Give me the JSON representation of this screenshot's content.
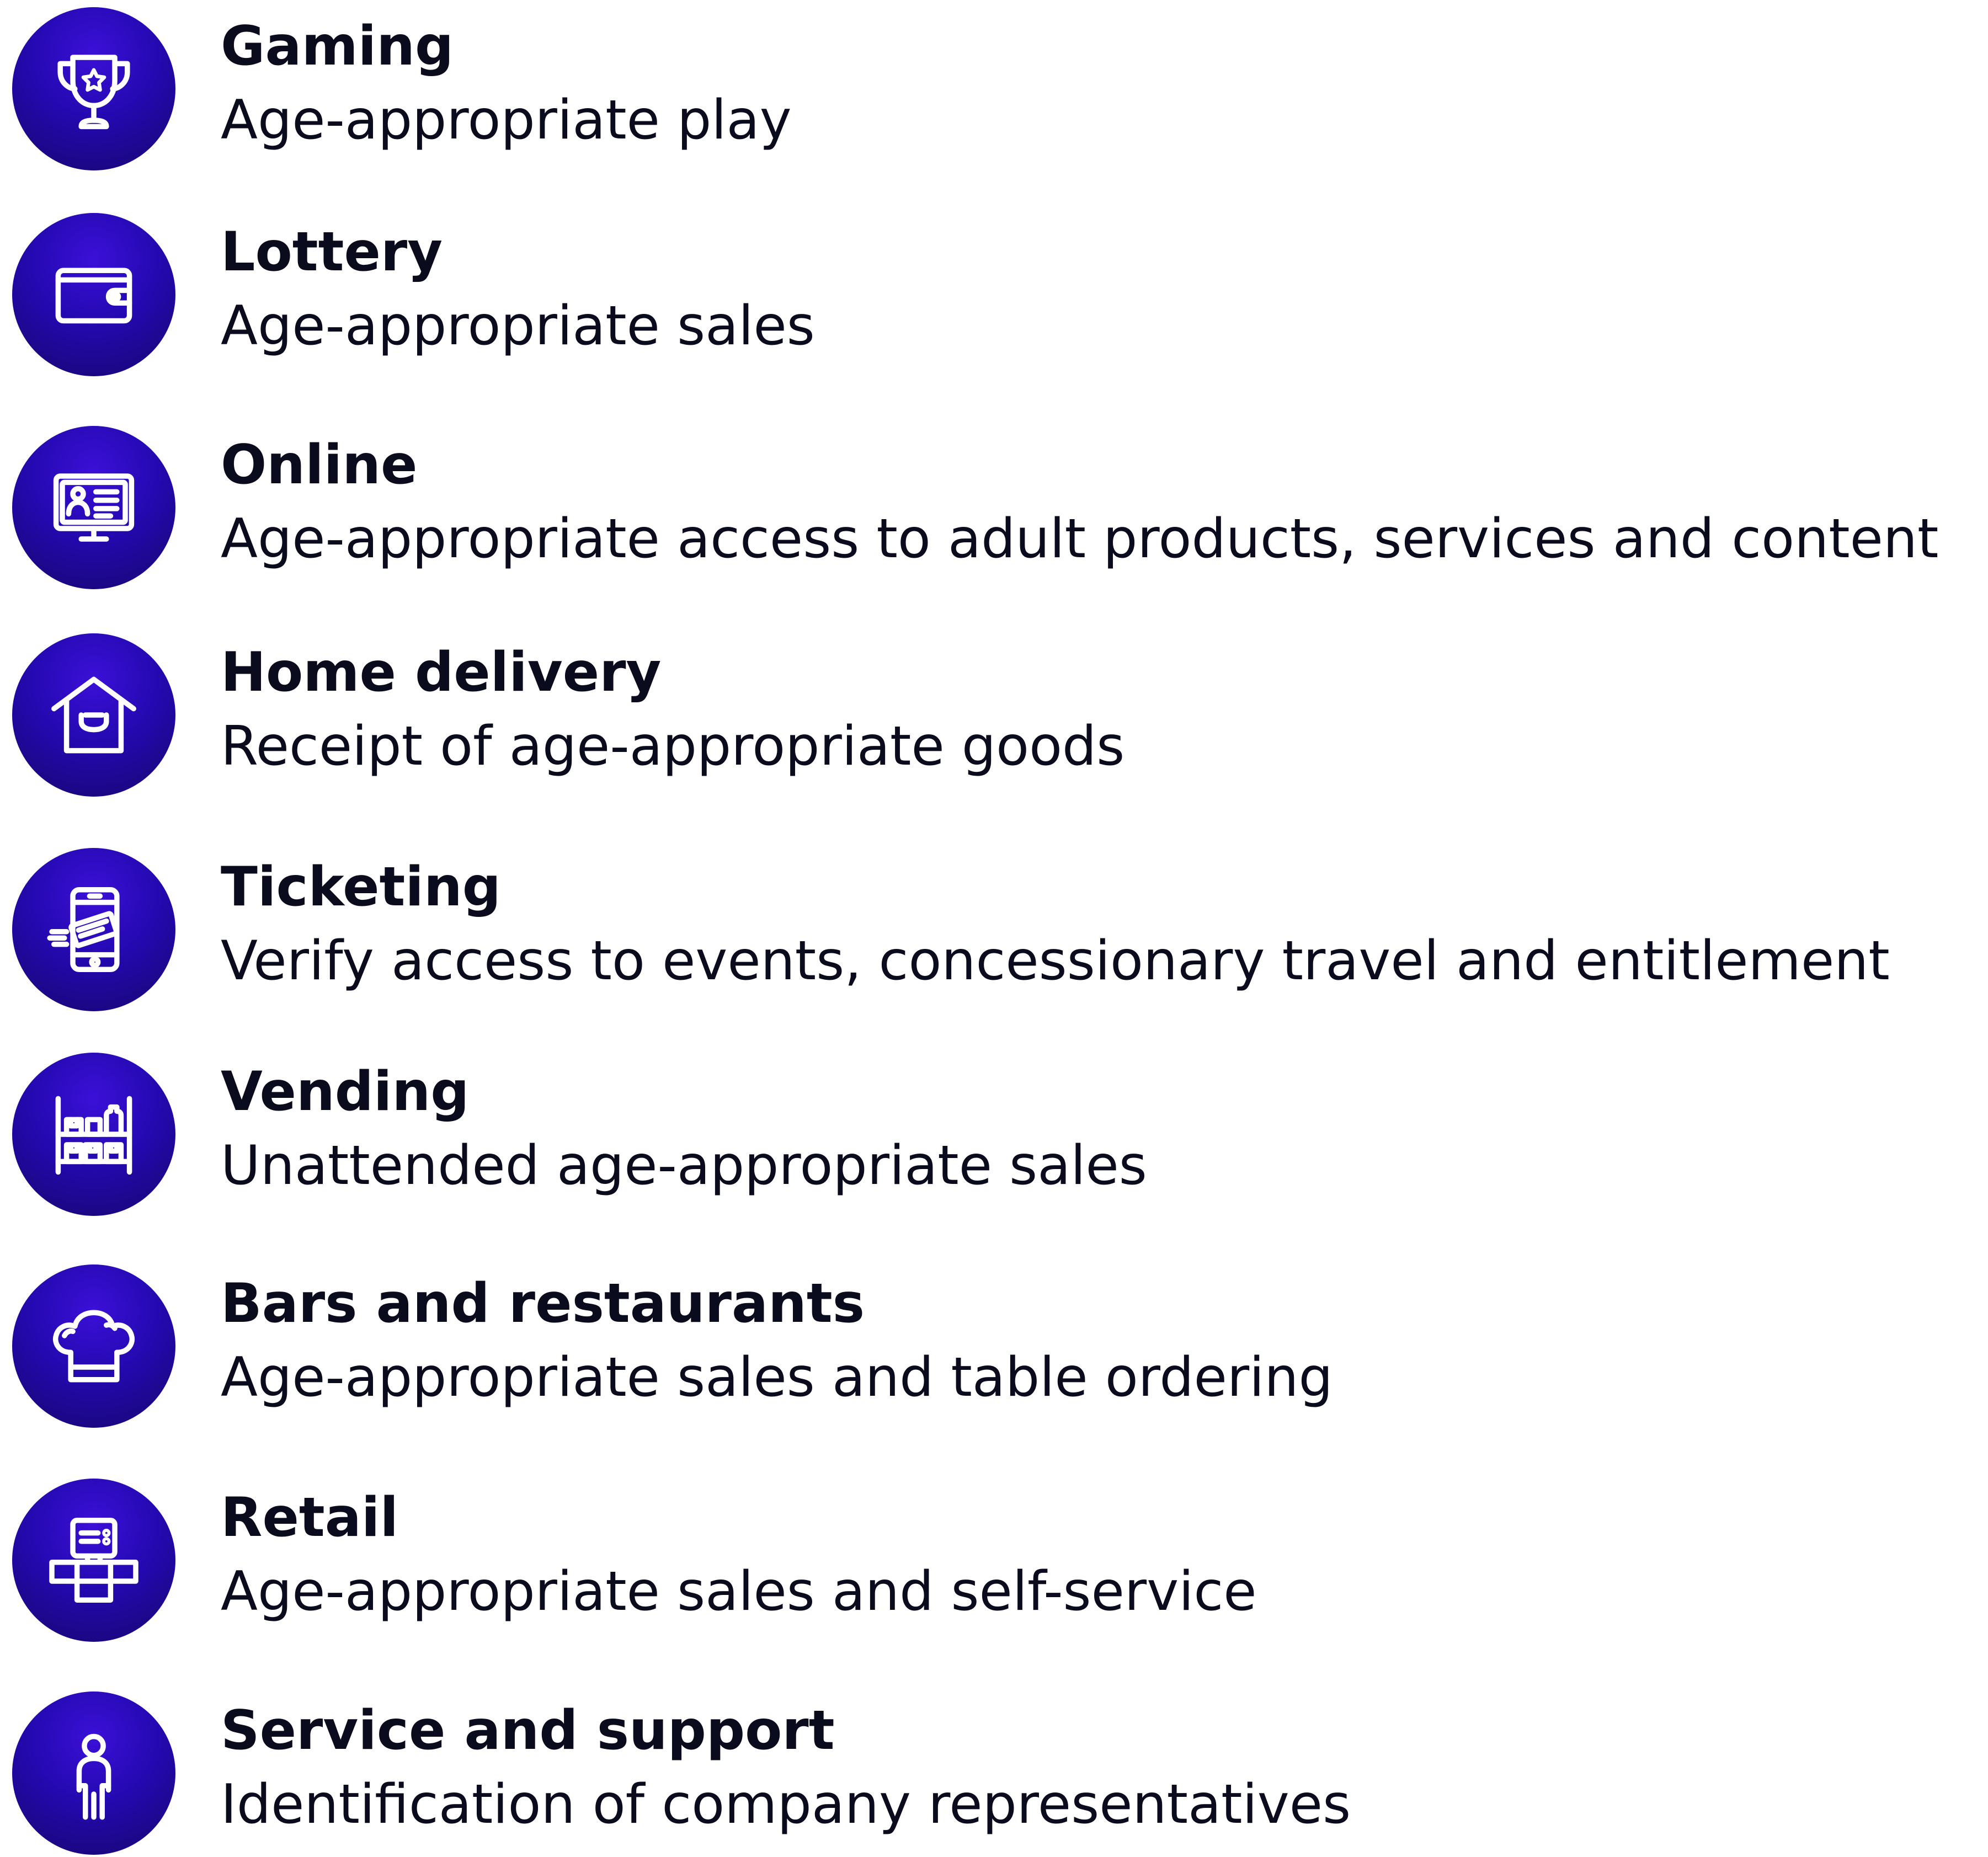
{
  "colors": {
    "icon_circle": "#2409b0",
    "icon_circle_dark": "#16066f",
    "icon_stroke": "#ffffff",
    "text": "#0b0b1e"
  },
  "items": [
    {
      "title": "Gaming",
      "description": "Age-appropriate play",
      "icon": "trophy-icon"
    },
    {
      "title": "Lottery",
      "description": "Age-appropriate sales",
      "icon": "wallet-icon"
    },
    {
      "title": "Online",
      "description": "Age-appropriate access to adult products, services and content",
      "icon": "monitor-profile-icon"
    },
    {
      "title": "Home delivery",
      "description": "Receipt of age-appropriate goods",
      "icon": "house-bag-icon"
    },
    {
      "title": "Ticketing",
      "description": "Verify access to events, concessionary travel and entitlement",
      "icon": "phone-ticket-icon"
    },
    {
      "title": "Vending",
      "description": "Unattended age-appropriate sales",
      "icon": "shelves-icon"
    },
    {
      "title": "Bars and restaurants",
      "description": "Age-appropriate sales and table ordering",
      "icon": "chef-hat-icon"
    },
    {
      "title": "Retail",
      "description": "Age-appropriate sales and self-service",
      "icon": "kiosk-icon"
    },
    {
      "title": "Service and support",
      "description": "Identification of company representatives",
      "icon": "person-icon"
    }
  ]
}
